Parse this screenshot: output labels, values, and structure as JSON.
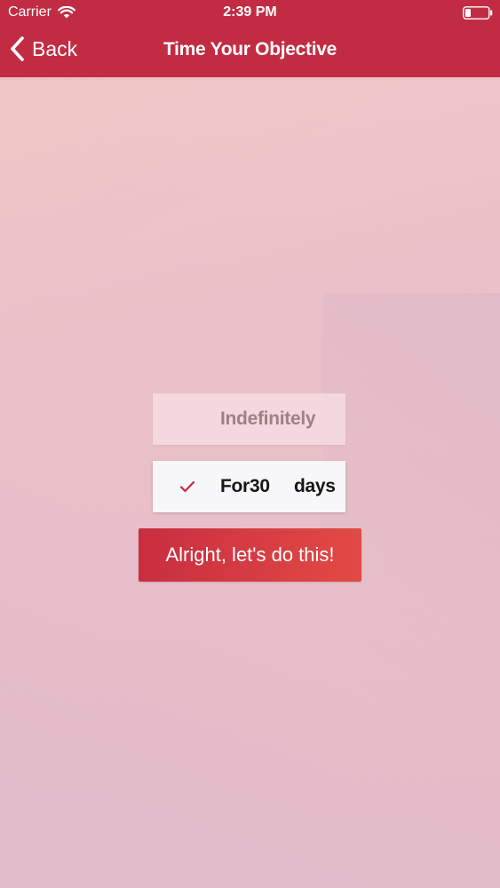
{
  "status_bar": {
    "carrier": "Carrier",
    "time": "2:39 PM"
  },
  "nav": {
    "back_label": "Back",
    "title": "Time Your Objective"
  },
  "options": {
    "indefinitely": {
      "label": "Indefinitely",
      "selected": false
    },
    "fixed": {
      "prefix": "For",
      "count": "30",
      "unit": "days",
      "selected": true
    }
  },
  "cta": {
    "label": "Alright, let's do this!"
  },
  "colors": {
    "brand": "#c22c43",
    "cta_start": "#c82e40",
    "cta_end": "#e24a45",
    "check": "#c22c43"
  },
  "icons": {
    "wifi": "wifi-icon",
    "battery": "battery-icon",
    "back": "chevron-left-icon",
    "check": "check-icon"
  }
}
